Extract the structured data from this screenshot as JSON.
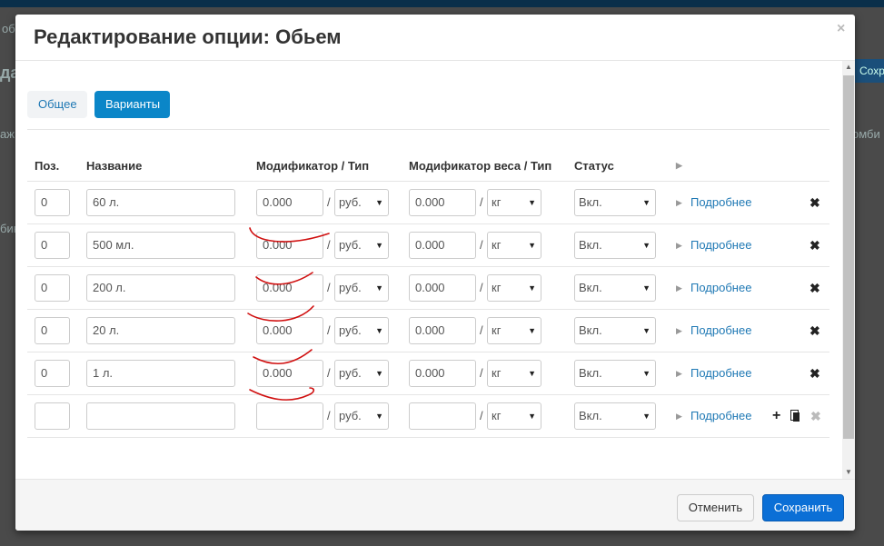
{
  "background": {
    "fragments": [
      "об",
      "да",
      "аж",
      "бин",
      "омби"
    ],
    "save_button": "Сохр"
  },
  "modal": {
    "title": "Редактирование опции: Обьем",
    "close": "×",
    "tabs": [
      {
        "label": "Общее",
        "active": false
      },
      {
        "label": "Варианты",
        "active": true
      }
    ],
    "columns": {
      "pos": "Поз.",
      "name": "Название",
      "modifier": "Модификатор / Тип",
      "weight_modifier": "Модификатор веса / Тип",
      "status": "Статус"
    },
    "rows": [
      {
        "pos": "0",
        "name": "60 л.",
        "modifier": "0.000",
        "modifier_type": "руб.",
        "weight": "0.000",
        "weight_type": "кг",
        "status": "Вкл.",
        "details": "Подробнее"
      },
      {
        "pos": "0",
        "name": "500 мл.",
        "modifier": "0.000",
        "modifier_type": "руб.",
        "weight": "0.000",
        "weight_type": "кг",
        "status": "Вкл.",
        "details": "Подробнее"
      },
      {
        "pos": "0",
        "name": "200 л.",
        "modifier": "0.000",
        "modifier_type": "руб.",
        "weight": "0.000",
        "weight_type": "кг",
        "status": "Вкл.",
        "details": "Подробнее"
      },
      {
        "pos": "0",
        "name": "20 л.",
        "modifier": "0.000",
        "modifier_type": "руб.",
        "weight": "0.000",
        "weight_type": "кг",
        "status": "Вкл.",
        "details": "Подробнее"
      },
      {
        "pos": "0",
        "name": "1 л.",
        "modifier": "0.000",
        "modifier_type": "руб.",
        "weight": "0.000",
        "weight_type": "кг",
        "status": "Вкл.",
        "details": "Подробнее"
      }
    ],
    "new_row": {
      "pos": "",
      "name": "",
      "modifier": "",
      "modifier_type": "руб.",
      "weight": "",
      "weight_type": "кг",
      "status": "Вкл.",
      "details": "Подробнее"
    },
    "separator": "/",
    "footer": {
      "cancel": "Отменить",
      "save": "Сохранить"
    },
    "colors": {
      "accent": "#0b86c8",
      "primary_button": "#0b6fd6",
      "link": "#1e78b4",
      "annotation": "#d01010"
    }
  }
}
